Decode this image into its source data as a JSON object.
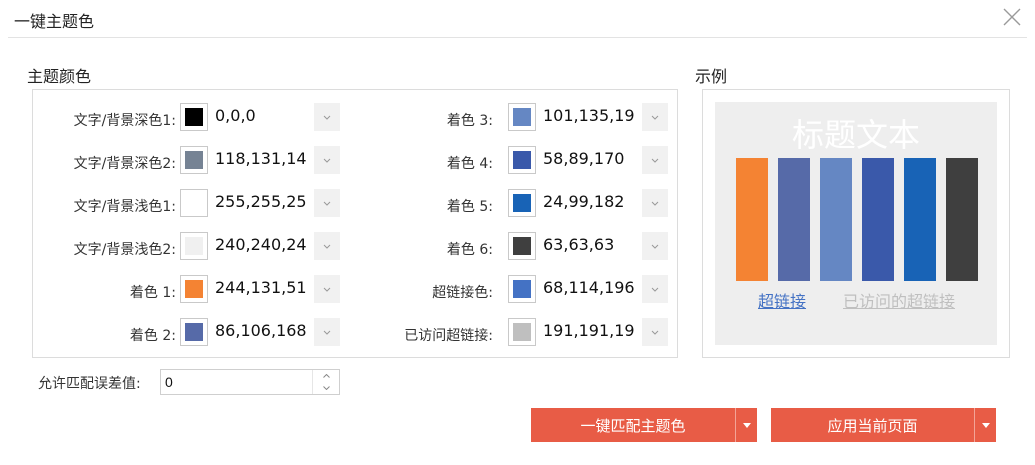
{
  "window": {
    "title": "一键主题色"
  },
  "sections": {
    "theme_colors": "主题颜色",
    "example": "示例"
  },
  "colors": [
    {
      "label": "文字/背景深色1:",
      "value": "0,0,0",
      "swatch": "#000000"
    },
    {
      "label": "文字/背景深色2:",
      "value": "118,131,14",
      "swatch": "#768394"
    },
    {
      "label": "文字/背景浅色1:",
      "value": "255,255,25",
      "swatch": "#ffffff"
    },
    {
      "label": "文字/背景浅色2:",
      "value": "240,240,24",
      "swatch": "#f0f0f0"
    },
    {
      "label": "着色 1:",
      "value": "244,131,51",
      "swatch": "#f48333"
    },
    {
      "label": "着色 2:",
      "value": "86,106,168",
      "swatch": "#566aa8"
    },
    {
      "label": "着色 3:",
      "value": "101,135,19",
      "swatch": "#6587c3"
    },
    {
      "label": "着色 4:",
      "value": "58,89,170",
      "swatch": "#3a59aa"
    },
    {
      "label": "着色 5:",
      "value": "24,99,182",
      "swatch": "#1863b6"
    },
    {
      "label": "着色 6:",
      "value": "63,63,63",
      "swatch": "#3f3f3f"
    },
    {
      "label": "超链接色:",
      "value": "68,114,196",
      "swatch": "#4472c4"
    },
    {
      "label": "已访问超链接:",
      "value": "191,191,19",
      "swatch": "#bfbfbf"
    }
  ],
  "preview": {
    "title": "标题文本",
    "bar_colors": [
      "#f48333",
      "#566aa8",
      "#6587c3",
      "#3a59aa",
      "#1863b6",
      "#3f3f3f"
    ],
    "hyperlink": "超链接",
    "hyperlink_color": "#4472c4",
    "visited_hyperlink": "已访问的超链接",
    "visited_color": "#bfbfbf"
  },
  "tolerance": {
    "label": "允许匹配误差值:",
    "value": "0"
  },
  "buttons": {
    "match": "一键匹配主题色",
    "apply": "应用当前页面"
  },
  "accent_color": "#e85c46"
}
